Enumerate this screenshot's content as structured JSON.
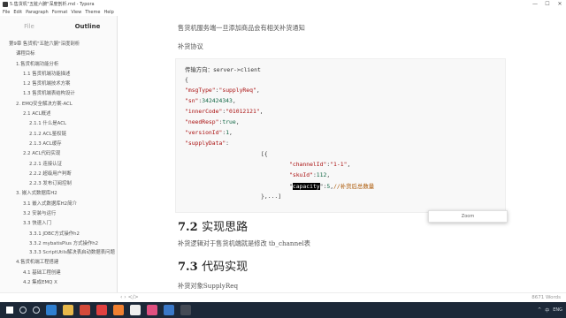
{
  "window": {
    "title": "5.售货机\"五脏六腑\"深度剖析.md - Typora",
    "controls": [
      "—",
      "☐",
      "✕"
    ]
  },
  "menu": [
    "File",
    "Edit",
    "Paragraph",
    "Format",
    "View",
    "Theme",
    "Help"
  ],
  "sidebar": {
    "tabs": [
      "File",
      "Outline"
    ],
    "outline": [
      {
        "label": "第9章 售货机\"五脏六腑\"深度剖析",
        "level": 0
      },
      {
        "label": "课程目标",
        "level": 1
      },
      {
        "label": "1.售货机端功能分析",
        "level": 1
      },
      {
        "label": "1.1 售货机端功能描述",
        "level": 2
      },
      {
        "label": "1.2 售货机端技术方案",
        "level": 2
      },
      {
        "label": "1.3 售货机端表结构设计",
        "level": 2
      },
      {
        "label": "2. EMQ安全解决方案-ACL",
        "level": 1
      },
      {
        "label": "2.1 ACL概述",
        "level": 2
      },
      {
        "label": "2.1.1 什么是ACL",
        "level": 3
      },
      {
        "label": "2.1.2 ACL鉴权链",
        "level": 3
      },
      {
        "label": "2.1.3 ACL缓存",
        "level": 3
      },
      {
        "label": "2.2 ACL代码实现",
        "level": 2
      },
      {
        "label": "2.2.1 连接认证",
        "level": 3
      },
      {
        "label": "2.2.2 超级用户判断",
        "level": 3
      },
      {
        "label": "2.2.3 发布订阅控制",
        "level": 3
      },
      {
        "label": "3. 嵌入式数据库H2",
        "level": 1
      },
      {
        "label": "3.1 嵌入式数据库H2简介",
        "level": 2
      },
      {
        "label": "3.2 安装与运行",
        "level": 2
      },
      {
        "label": "3.3 快速入门",
        "level": 2
      },
      {
        "label": "3.3.1 JDBC方式操作h2",
        "level": 3
      },
      {
        "label": "3.3.2 mybatisPlus 方式操作h2",
        "level": 3
      },
      {
        "label": "3.3.3 ScriptUtils解决表启动数据表问题",
        "level": 3
      },
      {
        "label": "4.售货机端工程搭建",
        "level": 1
      },
      {
        "label": "4.1 基础工程创建",
        "level": 2
      },
      {
        "label": "4.2 集成EMQ X",
        "level": 2
      }
    ]
  },
  "editor": {
    "top_text": "售货机服务端一旦添加商品会有相关补货通知",
    "section_label": "补货协议",
    "code": {
      "direction": "传输方向：server->client",
      "open_brace": "{",
      "msgType_key": "\"msgType\"",
      "msgType_val": "\"supplyReq\"",
      "sn_key": "\"sn\"",
      "sn_val": "342424343",
      "innerCode_key": "\"innerCode\"",
      "innerCode_val": "\"01012121\"",
      "needResp_key": "\"needResp\"",
      "needResp_val": "true",
      "versionId_key": "\"versionId\"",
      "versionId_val": "1",
      "supplyData_key": "\"supplyData\"",
      "array_open": "[{",
      "channelId_key": "\"channelId\"",
      "channelId_val": "\"1-1\"",
      "skuId_key": "\"skuId\"",
      "skuId_val": "112",
      "capacity_key": "capacity",
      "capacity_val": "5",
      "capacity_comment": "//补货后总数量",
      "array_close": "},...]"
    },
    "popup_text": "Zoom",
    "h2_a_num": "7.2",
    "h2_a_text": "实现思路",
    "para_a": "补货逻辑对于售货机端就是修改 tb_channel表",
    "h2_b_num": "7.3",
    "h2_b_text": "代码实现",
    "para_b": "补货对象SupplyReq"
  },
  "statusbar": {
    "left": "‹ ›  </>",
    "word_count": "8671 Words"
  },
  "taskbar": {
    "icons": [
      "start",
      "search",
      "task-view",
      "edge",
      "folder",
      "chrome",
      "app-red",
      "app-orange",
      "typora",
      "intellij",
      "app-blue",
      "app-dark"
    ],
    "icon_colors": [
      "#ffffff",
      "#cfd6de",
      "#cfd6de",
      "#2f7fd0",
      "#e8b84a",
      "#d44a3a",
      "#e04040",
      "#f08030",
      "#eeeeee",
      "#e05080",
      "#3a78c8",
      "#444a55"
    ],
    "tray": [
      "^",
      "中",
      "ENG"
    ]
  }
}
